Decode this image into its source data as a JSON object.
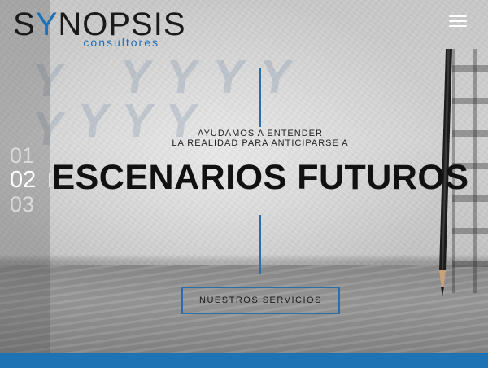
{
  "brand": {
    "name_prefix": "S",
    "name_accent": "Y",
    "name_rest": "NOPSIS",
    "subtitle": "consultores",
    "colors": {
      "accent": "#1d6fb8",
      "dark": "#1a1a1a"
    }
  },
  "header": {
    "menu_icon": "hamburger-menu-icon"
  },
  "slider": {
    "slides": [
      "01",
      "02",
      "03"
    ],
    "active": "02"
  },
  "hero": {
    "tagline_line1": "AYUDAMOS A ENTENDER",
    "tagline_line2": "LA REALIDAD PARA ANTICIPARSE A",
    "headline": "ESCENARIOS FUTUROS",
    "cta_label": "NUESTROS SERVICIOS",
    "decor_icons": [
      "pencil-icon",
      "ladder-shadow-icon"
    ]
  },
  "footer": {
    "bar_color": "#1e73b5"
  }
}
